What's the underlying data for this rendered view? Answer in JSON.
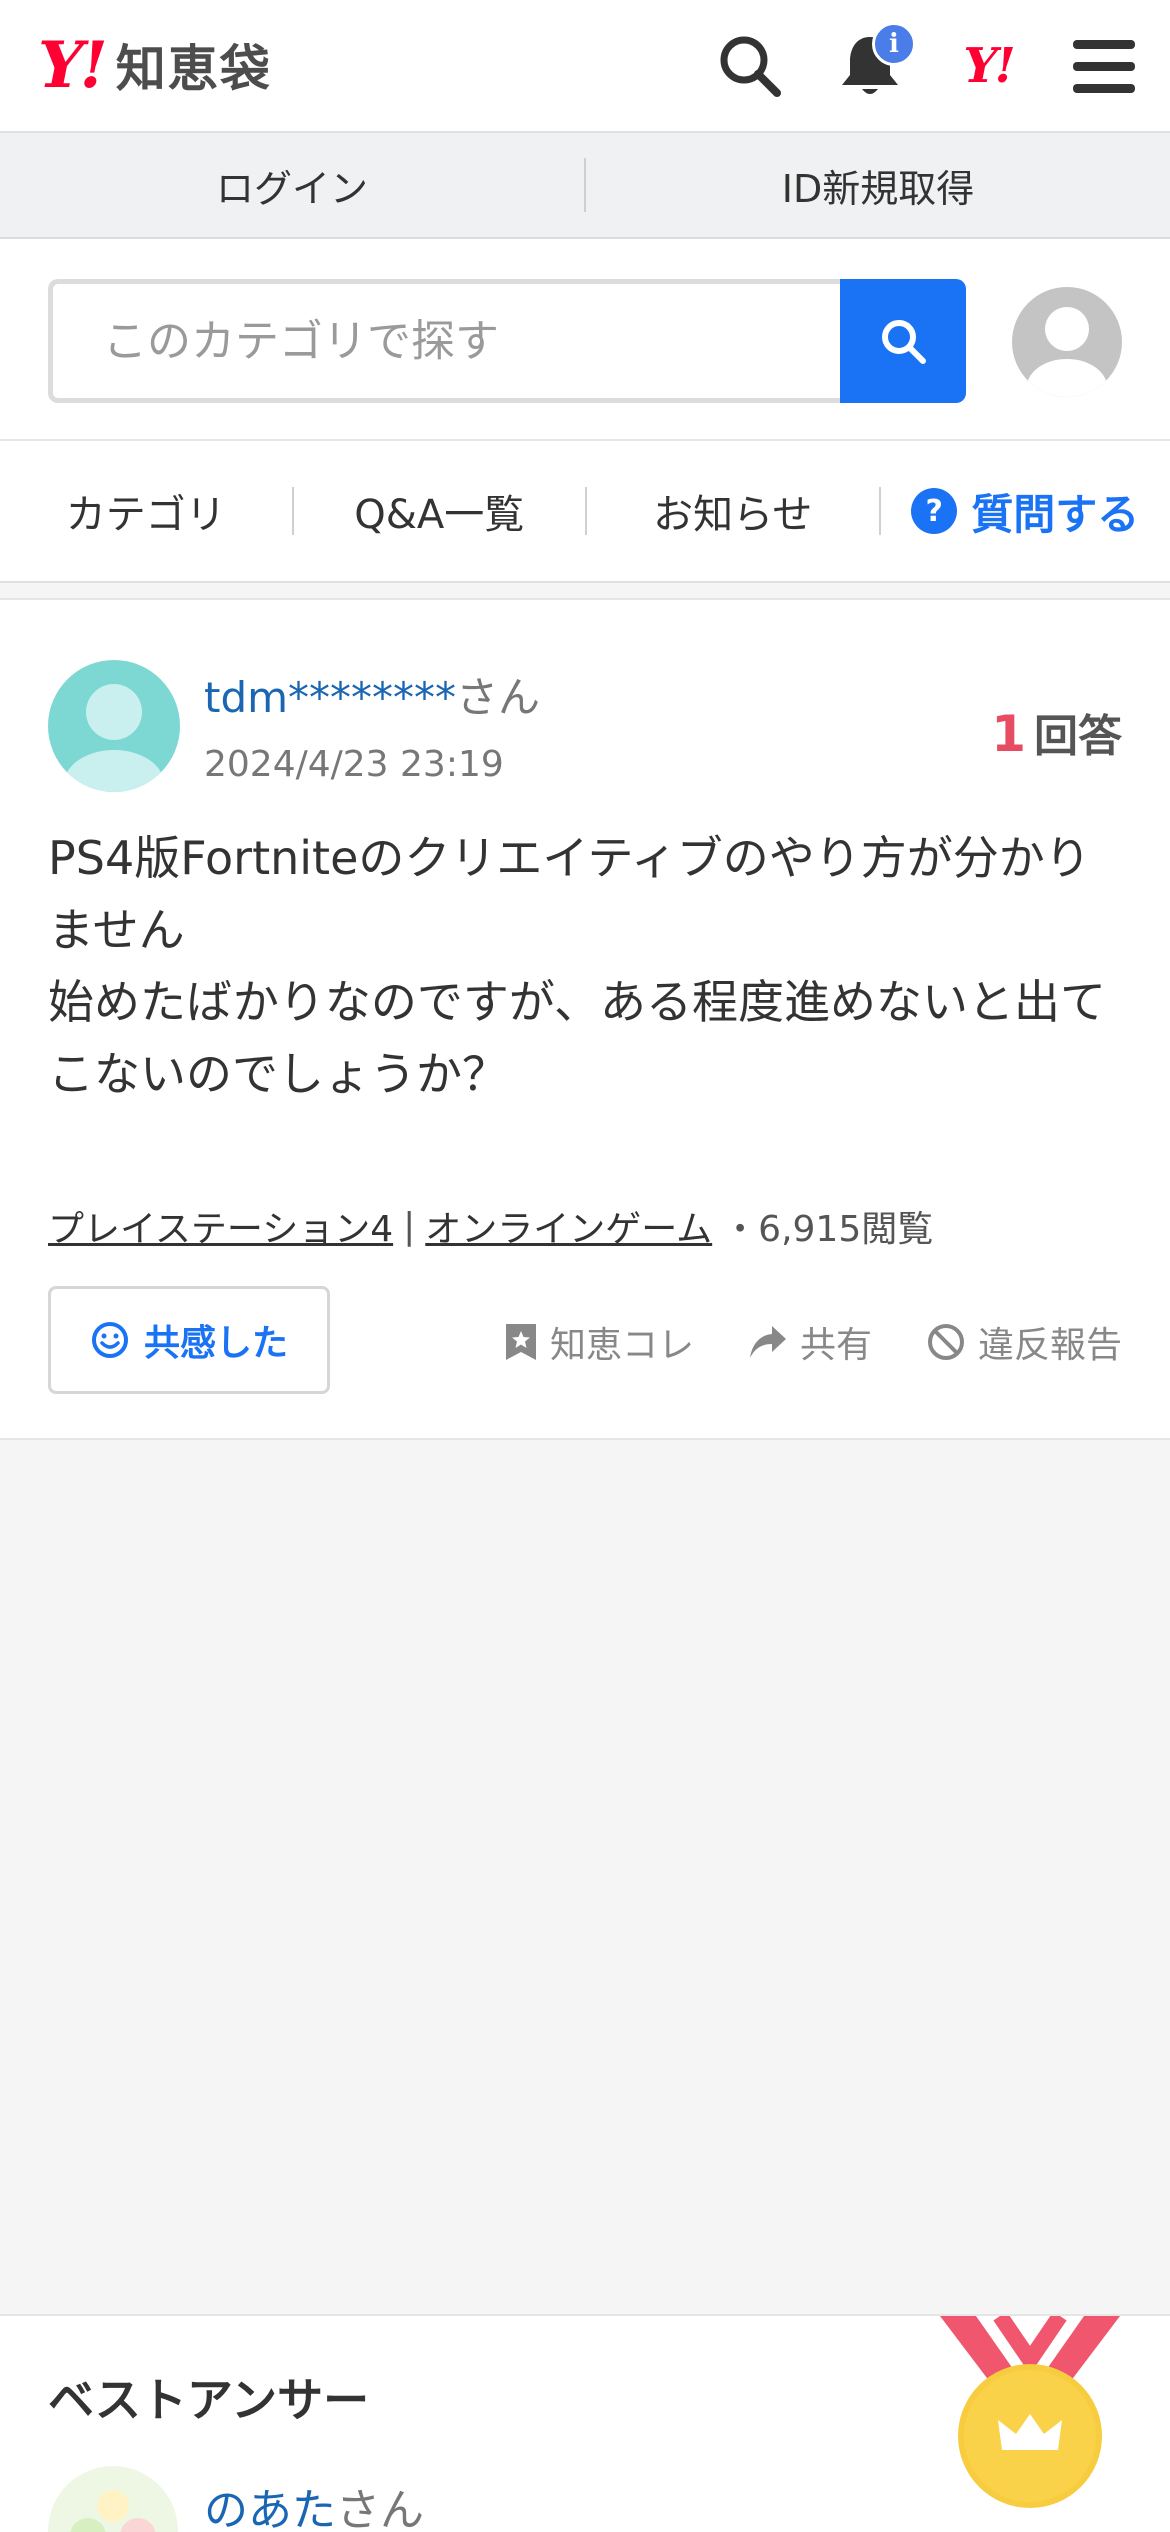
{
  "header": {
    "logo_mark": "Y!",
    "logo_text": "知恵袋",
    "notification_badge": "i",
    "yahoo_mark": "Y!"
  },
  "loginbar": {
    "login_label": "ログイン",
    "signup_label": "ID新規取得"
  },
  "search": {
    "placeholder": "このカテゴリで探す"
  },
  "nav": {
    "category": "カテゴリ",
    "qa_list": "Q&A一覧",
    "news": "お知らせ",
    "ask_icon": "?",
    "ask": "質問する"
  },
  "question": {
    "user_name": "tdm********",
    "user_suffix": "さん",
    "date": "2024/4/23 23:19",
    "answer_count": "1",
    "answer_label": "回答",
    "body": "PS4版Fortniteのクリエイティブのやり方が分かりません\n始めたばかりなのですが、ある程度進めないと出てこないのでしょうか？",
    "category_1": "プレイステーション4",
    "category_sep": "|",
    "category_2": "オンラインゲーム",
    "views": "・6,915閲覧",
    "empathy_label": "共感した",
    "collect_label": "知恵コレ",
    "share_label": "共有",
    "report_label": "違反報告"
  },
  "best_answer": {
    "title": "ベストアンサー",
    "user_name": "のあた",
    "user_suffix": "さん"
  },
  "colors": {
    "brand_red": "#ff0033",
    "link_blue": "#1a73f5",
    "answer_count_red": "#e84c62"
  }
}
